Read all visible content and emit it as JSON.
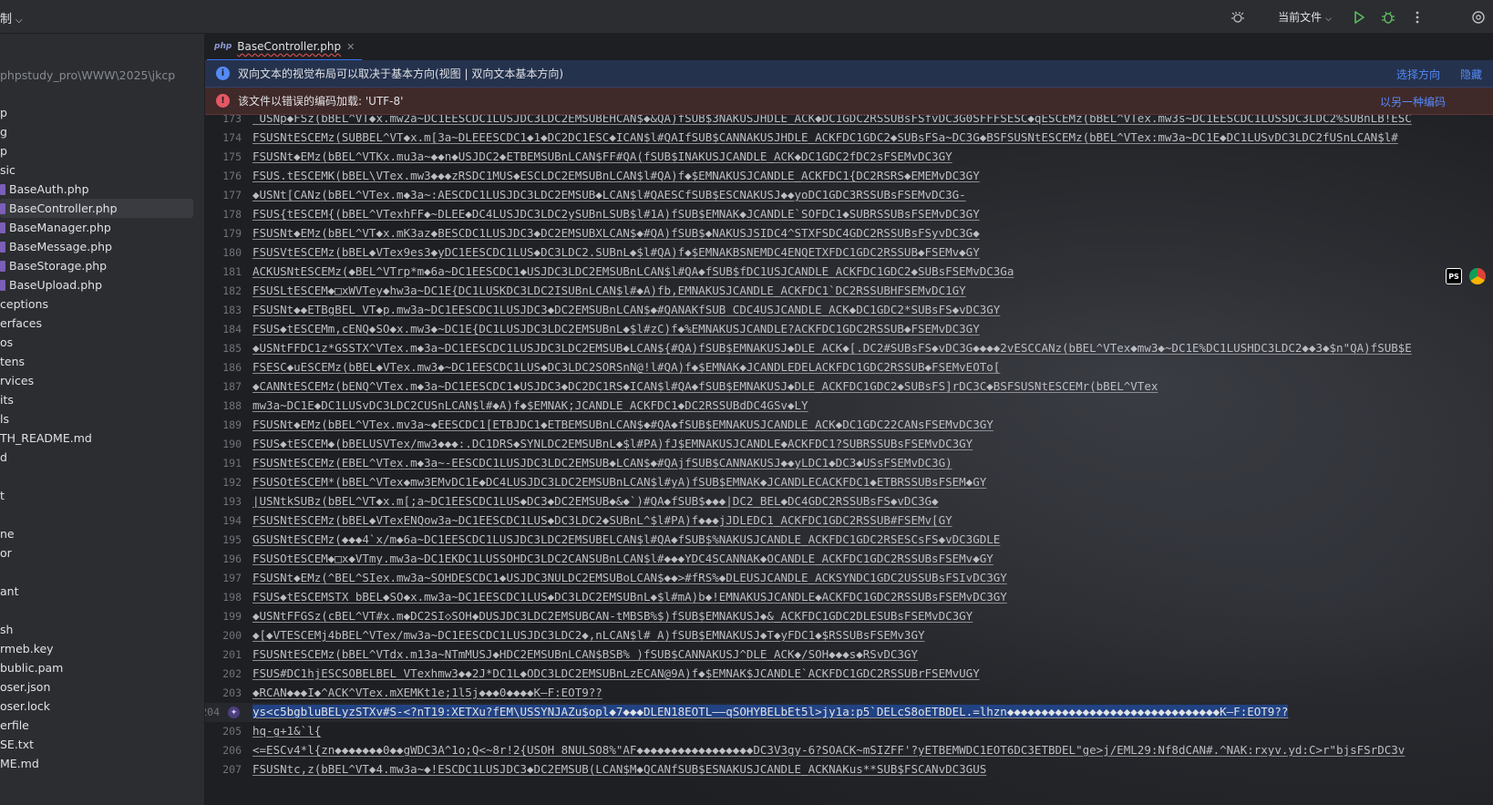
{
  "topbar": {
    "menu_left": "制",
    "run_config": "当前文件"
  },
  "sidebar": {
    "path": "phpstudy_pro\\WWW\\2025\\jkcp",
    "items": [
      {
        "label": "p"
      },
      {
        "label": "g"
      },
      {
        "label": "p"
      },
      {
        "label": "sic"
      },
      {
        "label": "BaseAuth.php"
      },
      {
        "label": "BaseController.php"
      },
      {
        "label": "BaseManager.php"
      },
      {
        "label": "BaseMessage.php"
      },
      {
        "label": "BaseStorage.php"
      },
      {
        "label": "BaseUpload.php"
      },
      {
        "label": "ceptions"
      },
      {
        "label": "erfaces"
      },
      {
        "label": "os"
      },
      {
        "label": "tens"
      },
      {
        "label": "rvices"
      },
      {
        "label": "its"
      },
      {
        "label": "ls"
      },
      {
        "label": "TH_README.md"
      },
      {
        "label": "d"
      },
      {
        "label": "t"
      },
      {
        "label": "ne"
      },
      {
        "label": "or"
      },
      {
        "label": "ant"
      },
      {
        "label": "sh"
      },
      {
        "label": "rmeb.key"
      },
      {
        "label": "bublic.pam"
      },
      {
        "label": "oser.json"
      },
      {
        "label": "oser.lock"
      },
      {
        "label": "erfile"
      },
      {
        "label": "SE.txt"
      },
      {
        "label": "ME.md"
      }
    ]
  },
  "editor": {
    "tab_label": "BaseController.php",
    "tab_type": "php",
    "info_banner": "双向文本的视觉布局可以取决于基本方向(视图 | 双向文本基本方向)",
    "info_action_1": "选择方向",
    "info_action_2": "隐藏",
    "error_banner": "该文件以错误的编码加载: 'UTF-8'",
    "error_action": "以另一种编码",
    "lines": [
      {
        "num": "173",
        "text": " USNp◆FSz(bBEL^VT◆x.mw2a~DC1EESCDC1LUSJDC3LDC2EMSUBEHCAN$◆&QA)fSUB$3NAKUSJHDLE_ACK◆DC1GDC2RSSUBsFSfvDC3G0SFFFSESC◆qESCEMz(bBEL^VTex.mw3s~DC1EESCDC1LUSSDC3LDC2%SUBnLB!ESC"
      },
      {
        "num": "174",
        "text": "FSUSNtESCEMz(SUBBEL^VT◆x.m[3a~DLEEESCDC1◆1◆DC2DC1ESC◆ICAN$l#QAIfSUB$CANNAKUSJHDLE_ACKFDC1GDC2◆SUBsFSa~DC3G◆BSFSUSNtESCEMz(bBEL^VTex:mw3a~DC1E◆DC1LUSvDC3LDC2fUSnLCAN$l#"
      },
      {
        "num": "175",
        "text": "FSUSNt◆EMz(bBEL^VTKx.mu3a~◆◆n◆USJDC2◆ETBEMSUBnLCAN$FF#QA(fSUB$INAKUSJCANDLE_ACK◆DC1GDC2fDC2sFSEMvDC3GY"
      },
      {
        "num": "176",
        "text": "FSUS.tESCEMK(bBEL\\VTex.mw3◆◆◆zRSDC1MUS◆ESCLDC2EMSUBnLCAN$l#QA)f◆$EMNAKUSJCANDLE_ACKFDC1{DC2RSRS◆EMEMvDC3GY"
      },
      {
        "num": "177",
        "text": "◆USNt[CANz(bBEL^VTex.m◆3a~:AESCDC1LUSJDC3LDC2EMSUB◆LCAN$l#QAESCfSUB$ESCNAKUSJ◆◆yoDC1GDC3RSSUBsFSEMvDC3G-"
      },
      {
        "num": "178",
        "text": "FSUS{tESCEM{(bBEL^VTexhFF◆~DLEE◆DC4LUSJDC3LDC2ySUBnLSUB$l#1A)fSUB$EMNAK◆JCANDLE`SOFDC1◆SUBRSSUBsFSEMvDC3GY"
      },
      {
        "num": "179",
        "text": "FSUSNt◆EMz(bBEL^VT◆x.mK3az◆BESCDC1LUSJDC3◆DC2EMSUBXLCAN$◆#QA)fSUB$◆NAKUSJSIDC4^STXFSDC4GDC2RSSUBsFSyvDC3G◆"
      },
      {
        "num": "180",
        "text": "FSUSVtESCEMz(bBEL◆VTex9es3◆yDC1EESCDC1LUS◆DC3LDC2.SUBnL◆$l#QA)f◆$EMNAKBSNEMDC4ENQETXFDC1GDC2RSSUB◆FSEMv◆GY"
      },
      {
        "num": "181",
        "text": "ACKUSNtESCEMz(◆BEL^VTrp*m◆6a~DC1EESCDC1◆USJDC3LDC2EMSUBnLCAN$l#QA◆fSUB$fDC1USJCANDLE_ACKFDC1GDC2◆SUBsFSEMvDC3Ga"
      },
      {
        "num": "182",
        "text": "FSUSLtESCEM◆□xWVTey◆hw3a~DC1E{DC1LUSKDC3LDC2ISUBnLCAN$l#◆A)fb,EMNAKUSJCANDLE_ACKFDC1`DC2RSSUBHFSEMvDC1GY"
      },
      {
        "num": "183",
        "text": "FSUSNt◆◆ETBgBEL_VT◆p.mw3a~DC1EESCDC1LUSJDC3◆DC2EMSUBnLCAN$◆#QANAKfSUB CDC4USJCANDLE_ACK◆DC1GDC2*SUBsFS◆vDC3GY"
      },
      {
        "num": "184",
        "text": "FSUS◆tESCEMm,cENQ◆SO◆x.mw3◆~DC1E{DC1LUSJDC3LDC2EMSUBnL◆$l#zC)f◆%EMNAKUSJCANDLE?ACKFDC1GDC2RSSUB◆FSEMvDC3GY"
      },
      {
        "num": "185",
        "text": "◆USNtFFDC1z*GSSTX^VTex.m◆3a~DC1EESCDC1LUSJDC3LDC2EMSUB◆LCAN${#QA)fSUB$EMNAKUSJ◆DLE_ACK◆[.DC2#SUBsFS◆vDC3G◆◆◆◆2vESCCANz(bBEL^VTex◆mw3◆~DC1E%DC1LUSHDC3LDC2◆◆3◆$n\"QA)fSUB$E"
      },
      {
        "num": "186",
        "text": "FSESC◆uESCEMz(bBEL◆VTex.mw3◆~DC1EESCDC1LUS◆DC3LDC2SORSnN@!l#QA)f◆$EMNAK◆JCANDLEDELACKFDC1GDC2RSSUB◆FSEMvEOTo["
      },
      {
        "num": "187",
        "text": "◆CANNtESCEMz(bENQ^VTex.m◆3a~DC1EESCDC1◆USJDC3◆DC2DC1RS◆ICAN$l#QA◆fSUB$EMNAKUSJ◆DLE_ACKFDC1GDC2◆SUBsFS]rDC3C◆BSFSUSNtESCEMr(bBEL^VTex"
      },
      {
        "num": "188",
        "text": "mw3a~DC1E◆DC1LUSvDC3LDC2CUSnLCAN$l#◆A)f◆$EMNAK;JCANDLE_ACKFDC1◆DC2RSSUBdDC4GSv◆LY"
      },
      {
        "num": "189",
        "text": "FSUSNt◆EMz(bBEL^VTex.mv3a~◆EESCDC1[ETBJDC1◆ETBEMSUBnLCAN$◆#QA◆fSUB$EMNAKUSJCANDLE_ACK◆DC1GDC22CANsFSEMvDC3GY"
      },
      {
        "num": "190",
        "text": "FSUS◆tESCEM◆(bBELUSVTex/mw3◆◆◆:.DC1DRS◆SYNLDC2EMSUBnL◆$l#PA)fJ$EMNAKUSJCANDLE◆ACKFDC1?SUBRSSUBsFSEMvDC3GY"
      },
      {
        "num": "191",
        "text": "FSUSNtESCEMz(EBEL^VTex.m◆3a~-EESCDC1LUSJDC3LDC2EMSUB◆LCAN$◆#QAjfSUB$CANNAKUSJ◆◆yLDC1◆DC3◆USsFSEMvDC3G)"
      },
      {
        "num": "192",
        "text": "FSUSOtESCEM*(bBEL^VTex◆mw3EMvDC1E◆DC4LUSJDC3LDC2EMSUBnLCAN$l#yA)fSUB$EMNAK◆JCANDLECACKFDC1◆ETBRSSUBsFSEM◆GY"
      },
      {
        "num": "193",
        "text": "|USNtkSUBz(bBEL^VT◆x.m[;a~DC1EESCDC1LUS◆DC3◆DC2EMSUB◆&◆`)#QA◆fSUB$◆◆◆|DC2_BEL◆DC4GDC2RSSUBsFS◆vDC3G◆"
      },
      {
        "num": "194",
        "text": "FSUSNtESCEMz(bBEL◆VTexENQow3a~DC1EESCDC1LUS◆DC3LDC2◆SUBnL^$l#PA)f◆◆◆jJDLEDC1_ACKFDC1GDC2RSSUB#FSEMv[GY"
      },
      {
        "num": "195",
        "text": "GSUSNtESCEMz(◆◆◆4`x/m◆6a~DC1EESCDC1LUSJDC3LDC2EMSUBELCAN$l#QA◆fSUB$%NAKUSJCANDLE_ACKFDC1GDC2RSESCsFS◆vDC3GDLE"
      },
      {
        "num": "196",
        "text": "FSUSOtESCEM◆□x◆VTmy.mw3a~DC1EKDC1LUSSOHDC3LDC2CANSUBnLCAN$l#◆◆◆YDC4SCANNAK◆OCANDLE_ACKFDC1GDC2RSSUBsFSEMv◆GY"
      },
      {
        "num": "197",
        "text": "FSUSNt◆EMz(^BEL^SIex.mw3a~SOHDESCDC1◆USJDC3NULDC2EMSUBoLCAN$◆◆>#fRS%◆DLEUSJCANDLE_ACKSYNDC1GDC2USSUBsFSIvDC3GY"
      },
      {
        "num": "198",
        "text": "FSUS◆tESCEMSTX bBEL◆SO◆x.mw3a~DC1EESCDC1LUS◆DC3LDC2EMSUBnL◆$l#mA)b◆!EMNAKUSJCANDLE◆ACKFDC1GDC2RSSUBsFSEMvDC3GY"
      },
      {
        "num": "199",
        "text": "◆USNtFFGSz(cBEL^VT#x.m◆DC2SI◇SOH◆DUSJDC3LDC2EMSUBCAN-tMBSB%$)fSUB$EMNAKUSJ◆&_ACKFDC1GDC2DLESUBsFSEMvDC3GY"
      },
      {
        "num": "200",
        "text": "◆[◆VTESCEMj4bBEL^VTex/mw3a~DC1EESCDC1LUSJDC3LDC2◆,nLCAN$l#_A)fSUB$EMNAKUSJ◆T◆yFDC1◆$RSSUBsFSEMv3GY"
      },
      {
        "num": "201",
        "text": "FSUSNtESCEMz(bBEL^VTdx.m13a~NTmMUSJ◆HDC2EMSUBnLCAN$BSB% )fSUB$CANNAKUSJ^DLE_ACK◆/SOH◆◆◆s◆RSvDC3GY"
      },
      {
        "num": "202",
        "text": "FSUS#DC1hjESCSOBELBEL_VTexhmw3◆◆2J*DC1L◆ODC3LDC2EMSUBnLzECAN@9A)f◆$EMNAK$JCANDLE`ACKFDC1GDC2RSSUBrFSEMvUGY"
      },
      {
        "num": "203",
        "text": "◆RCAN◆◆◆I◆^ACK^VTex.mXEMKt1e;1l5j◆◆◆0◆◆◆◆K—F:EOT9??"
      },
      {
        "num": "204",
        "text": "ys<c5bgbluBELyzSTXv#S-<?nT19:XETXu?fEM\\USSYNJAZu$opl◆7◆◆◆DLEN18EOTL——qSOHYBELbEt5l>jy1a:p5`DELcS8oETBDEL.=lhzn◆◆◆◆◆◆◆◆◆◆◆◆◆◆◆◆◆◆◆◆◆◆◆◆◆◆◆◆◆◆◆K—F:EOT9??"
      },
      {
        "num": "205",
        "text": "hq-g+1&`l{"
      },
      {
        "num": "206",
        "text": "<=ESCv4*l{zn◆◆◆◆◆◆◆0◆◆gWDC3A^1o;Q<~8r!2{USOH 8NULSO8%\"AF◆◆◆◆◆◆◆◆◆◆◆◆◆◆◆◆◆DC3V3gy-6?SOACK~mSIZFF'?yETBEMWDC1EOT6DC3ETBDEL\"ge>j/EML29:Nf8dCAN#.^NAK:rxyv.yd:C>r\"bjsFSrDC3v"
      },
      {
        "num": "207",
        "text": "FSUSNtc,z(bBEL^VT◆4.mw3a~◆!ESCDC1LUSJDC3◆DC2EMSUB(LCAN$M◆QCANfSUB$ESNAKUSJCANDLE_ACKNAKus**SUB$FSCANvDC3GUS"
      }
    ]
  }
}
